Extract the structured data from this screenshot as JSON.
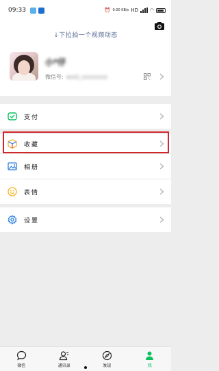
{
  "status_bar": {
    "time": "09:33",
    "network": "HD",
    "speed": "0.00 KB/s",
    "colors": {
      "app1": "#5ab0e8",
      "app2": "#1f6fd1"
    }
  },
  "profile": {
    "video_status_label": "↓下拉拍一个视频动态",
    "nickname": "小*仔",
    "wechat_id_label": "微信号:",
    "wechat_id_value": "wxid_xxxxxxxx"
  },
  "menu": {
    "items": [
      {
        "key": "pay",
        "label": "支付",
        "icon": "pay-icon",
        "color": "#07c160"
      },
      {
        "key": "favorites",
        "label": "收藏",
        "icon": "favorites-cube-icon",
        "color": "#f5a623"
      },
      {
        "key": "album",
        "label": "相册",
        "icon": "album-icon",
        "color": "#2f7fe0"
      },
      {
        "key": "stickers",
        "label": "表情",
        "icon": "emoji-icon",
        "color": "#f5b323"
      },
      {
        "key": "settings",
        "label": "设置",
        "icon": "settings-gear-icon",
        "color": "#2f7fe0"
      }
    ]
  },
  "tab_bar": {
    "tabs": [
      {
        "label": "微信",
        "icon": "chat-bubble-icon"
      },
      {
        "label": "通讯录",
        "icon": "contacts-icon"
      },
      {
        "label": "发现",
        "icon": "compass-icon"
      },
      {
        "label": "我",
        "icon": "me-icon",
        "active": true
      }
    ],
    "accent": "#07c160"
  }
}
